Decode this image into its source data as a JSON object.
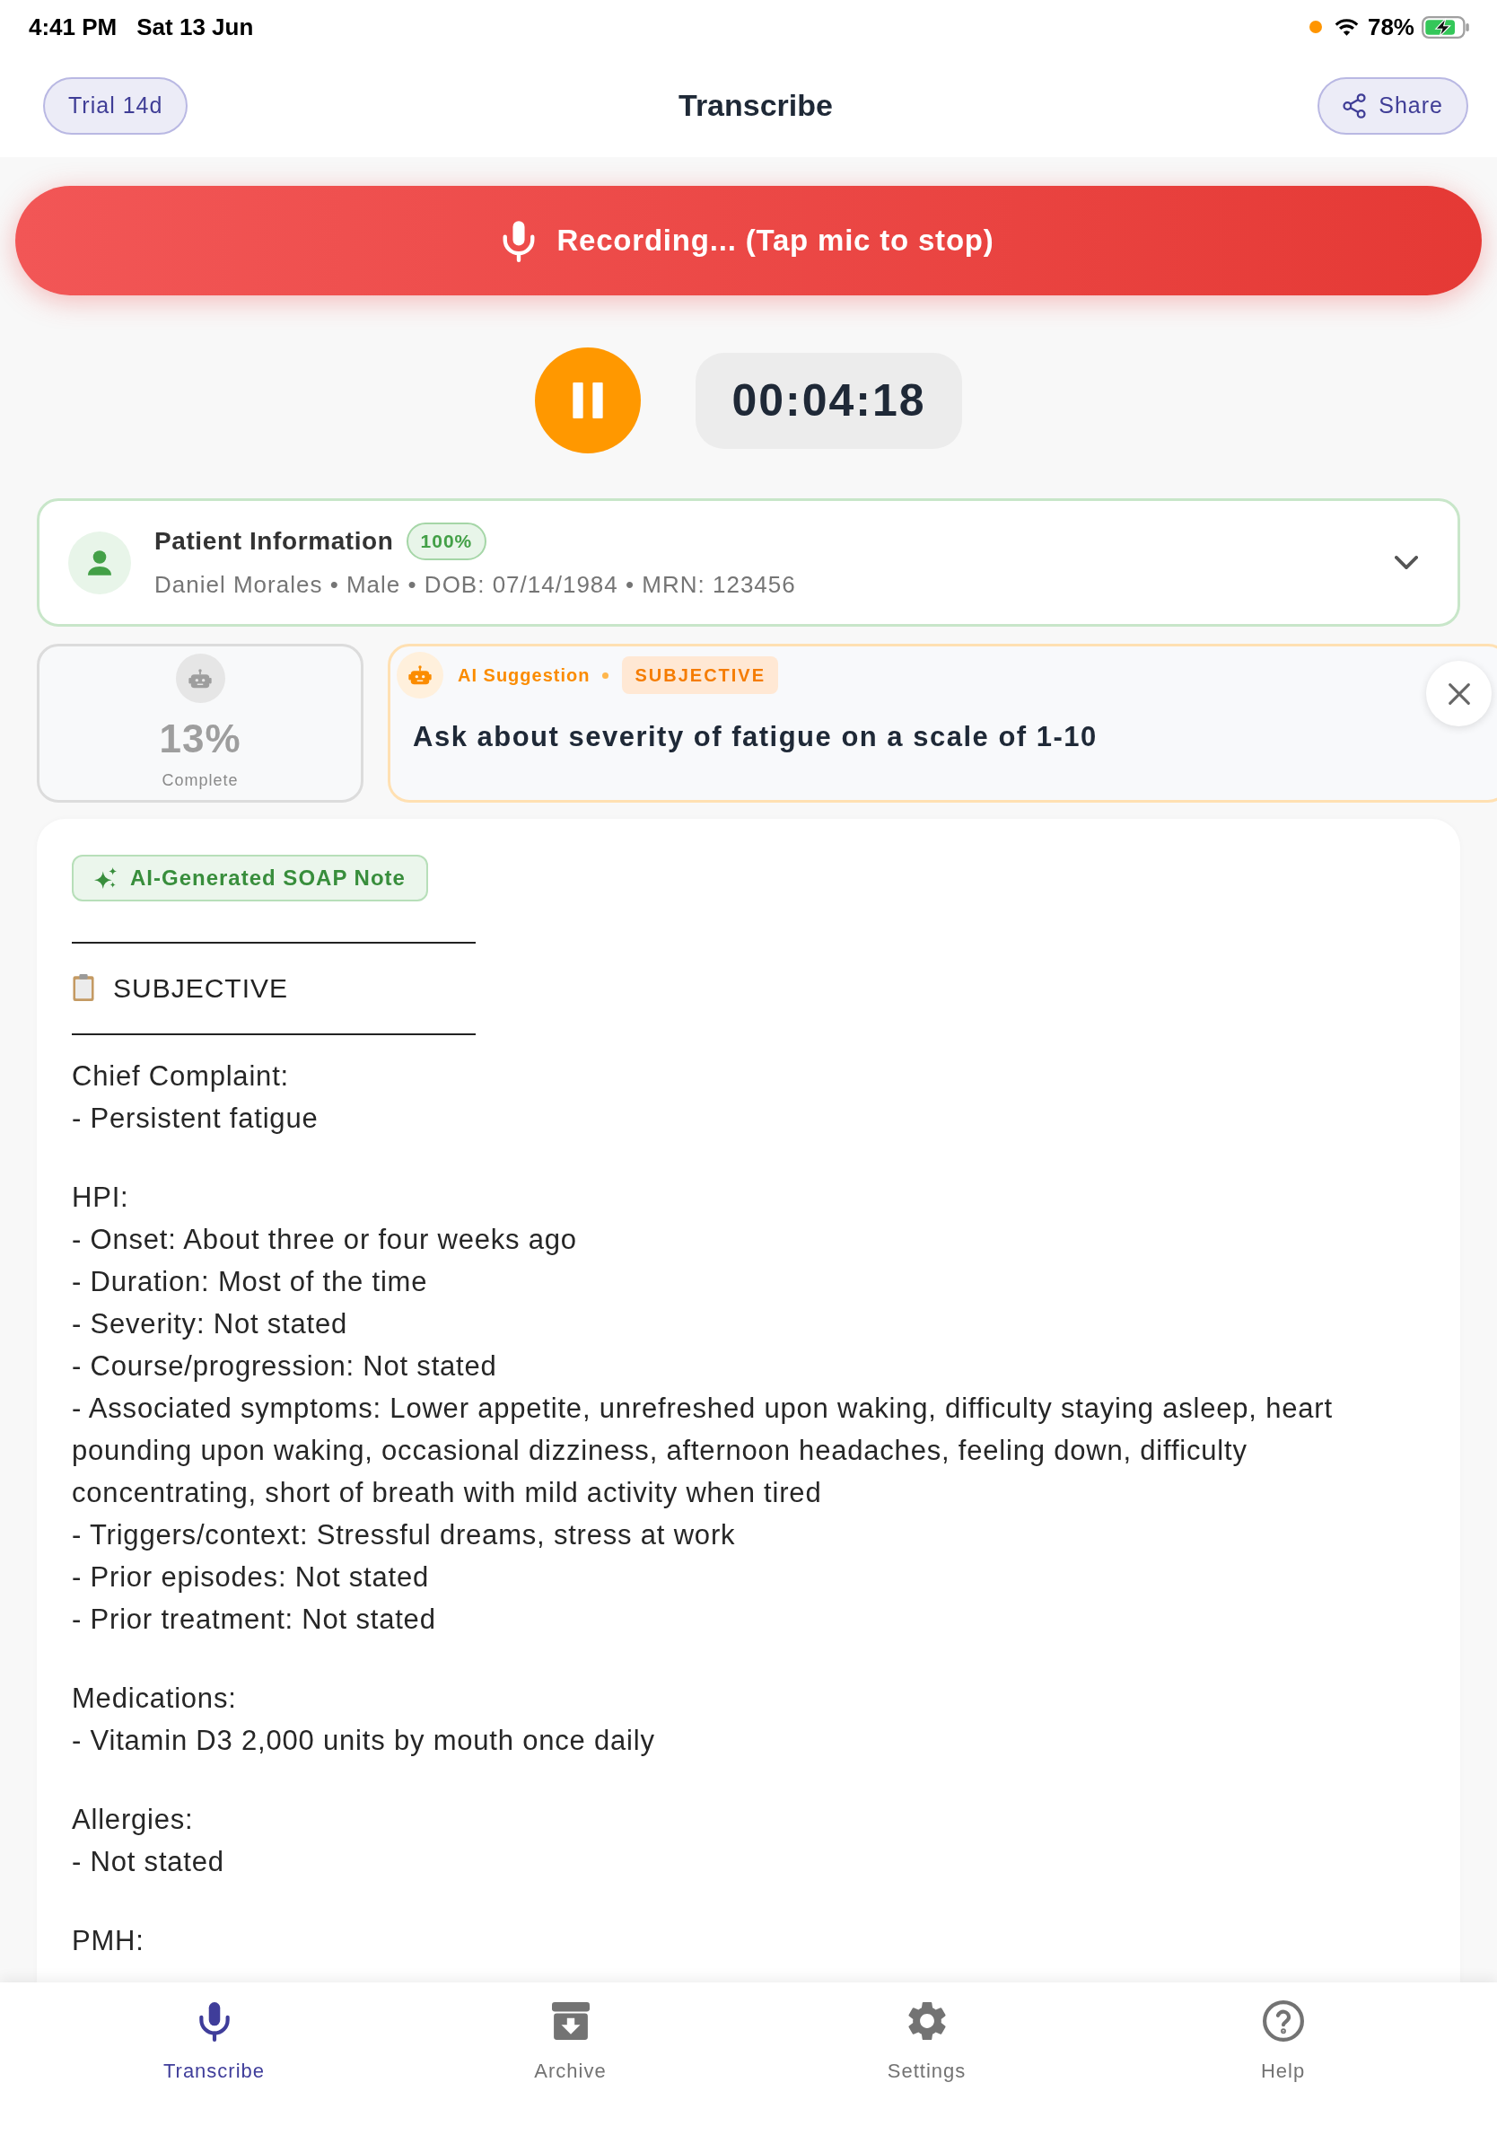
{
  "status_bar": {
    "time": "4:41 PM",
    "date": "Sat 13 Jun",
    "battery": "78%"
  },
  "header": {
    "trial": "Trial 14d",
    "title": "Transcribe",
    "share": "Share"
  },
  "recording": {
    "label": "Recording... (Tap mic to stop)",
    "timer": "00:04:18"
  },
  "patient": {
    "title": "Patient Information",
    "completeness": "100%",
    "details": "Daniel Morales • Male • DOB: 07/14/1984 • MRN: 123456",
    "expanded": false
  },
  "progress": {
    "value": "13%",
    "label": "Complete"
  },
  "suggestion": {
    "label": "AI Suggestion",
    "section": "SUBJECTIVE",
    "text": "Ask about severity of fatigue on a scale of 1-10"
  },
  "note": {
    "badge": "AI-Generated SOAP Note",
    "rule_above": "———————————————",
    "section_title": "SUBJECTIVE",
    "rule_below": "———————————————",
    "paragraphs": [
      {
        "lines": [
          "Chief Complaint:",
          "- Persistent fatigue"
        ]
      },
      {
        "lines": [
          "HPI:",
          "- Onset: About three or four weeks ago",
          "- Duration: Most of the time",
          "- Severity: Not stated",
          "- Course/progression: Not stated",
          "- Associated symptoms: Lower appetite, unrefreshed upon waking, difficulty staying asleep, heart pounding upon waking, occasional dizziness, afternoon headaches, feeling down, difficulty concentrating, short of breath with mild activity when tired",
          "- Triggers/context: Stressful dreams, stress at work",
          "- Prior episodes: Not stated",
          "- Prior treatment: Not stated"
        ]
      },
      {
        "lines": [
          "Medications:",
          "- Vitamin D3 2,000 units by mouth once daily"
        ]
      },
      {
        "lines": [
          "Allergies:",
          "- Not stated"
        ]
      },
      {
        "lines": [
          "PMH:"
        ]
      }
    ]
  },
  "tab_bar": [
    {
      "label": "Transcribe",
      "selected": true
    },
    {
      "label": "Archive",
      "selected": false
    },
    {
      "label": "Settings",
      "selected": false
    },
    {
      "label": "Help",
      "selected": false
    }
  ]
}
